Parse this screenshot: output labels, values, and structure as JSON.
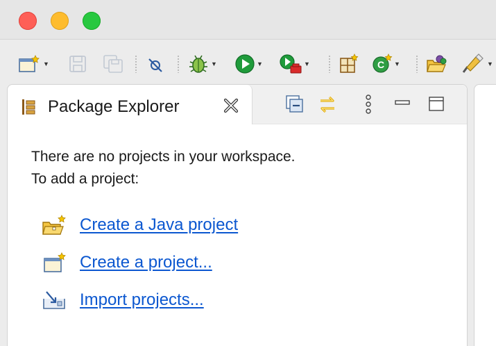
{
  "window": {
    "controls": [
      "close",
      "minimize",
      "maximize"
    ]
  },
  "toolbar": {
    "icons": [
      "new-wizard-icon",
      "save-icon",
      "save-all-icon",
      "skip-breakpoints-icon",
      "debug-icon",
      "run-icon",
      "external-tools-icon",
      "new-java-package-icon",
      "new-java-class-icon",
      "open-type-icon",
      "search-icon"
    ]
  },
  "package_explorer": {
    "tab_label": "Package Explorer",
    "message_line1": "There are no projects in your workspace.",
    "message_line2": "To add a project:",
    "links": {
      "java_project": "Create a Java project",
      "project": "Create a project...",
      "import": "Import projects..."
    }
  },
  "colors": {
    "link": "#0b57d0",
    "close": "#fe5f57",
    "minimize": "#febc2e",
    "maximize": "#28c840"
  }
}
